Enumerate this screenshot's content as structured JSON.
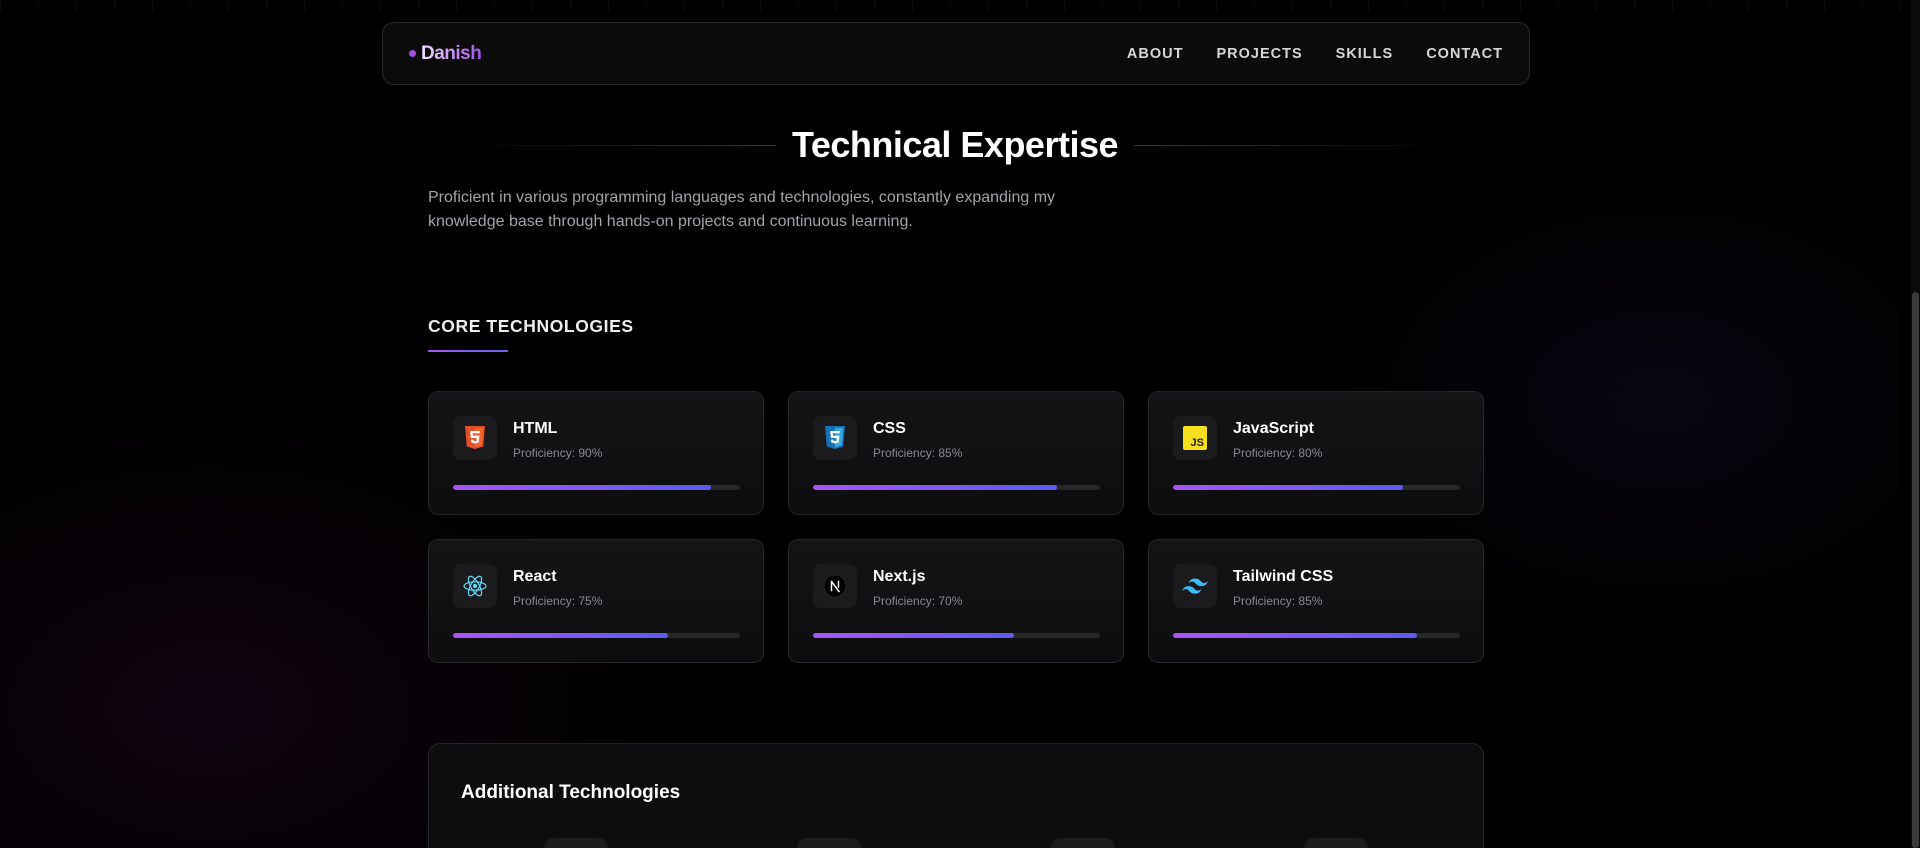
{
  "nav": {
    "logo": "Danish",
    "links": [
      "ABOUT",
      "PROJECTS",
      "SKILLS",
      "CONTACT"
    ]
  },
  "section": {
    "title": "Technical Expertise",
    "description": "Proficient in various programming languages and technologies, constantly expanding my knowledge base through hands-on projects and continuous learning."
  },
  "core": {
    "heading": "CORE TECHNOLOGIES",
    "items": [
      {
        "name": "HTML",
        "proficiency_label": "Proficiency: 90%",
        "proficiency": 90,
        "icon": "html5-icon",
        "color": "#e34f26"
      },
      {
        "name": "CSS",
        "proficiency_label": "Proficiency: 85%",
        "proficiency": 85,
        "icon": "css3-icon",
        "color": "#1572b6"
      },
      {
        "name": "JavaScript",
        "proficiency_label": "Proficiency: 80%",
        "proficiency": 80,
        "icon": "javascript-icon",
        "color": "#f7df1e"
      },
      {
        "name": "React",
        "proficiency_label": "Proficiency: 75%",
        "proficiency": 75,
        "icon": "react-icon",
        "color": "#61dafb"
      },
      {
        "name": "Next.js",
        "proficiency_label": "Proficiency: 70%",
        "proficiency": 70,
        "icon": "nextjs-icon",
        "color": "#ffffff"
      },
      {
        "name": "Tailwind CSS",
        "proficiency_label": "Proficiency: 85%",
        "proficiency": 85,
        "icon": "tailwind-icon",
        "color": "#38bdf8"
      }
    ]
  },
  "additional": {
    "title": "Additional Technologies"
  },
  "colors": {
    "accent_start": "#a855f7",
    "accent_end": "#5b5cf0",
    "background": "#000000"
  }
}
